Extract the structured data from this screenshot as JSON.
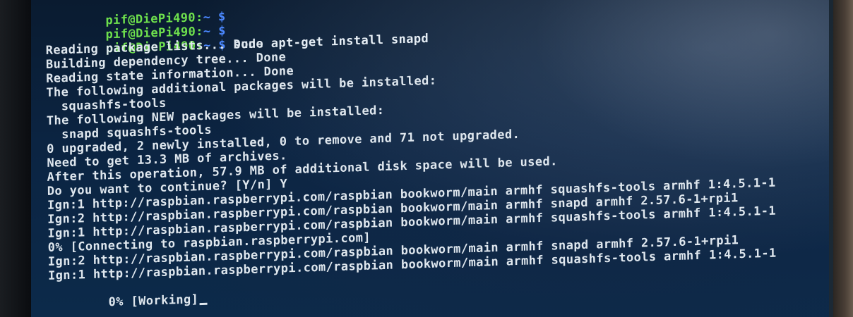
{
  "terminal": {
    "prompts": [
      {
        "user_host": "pif@DiePi490:",
        "path": "~",
        "symbol": "$",
        "command": ""
      },
      {
        "user_host": "pif@DiePi490:",
        "path": "~",
        "symbol": "$",
        "command": ""
      },
      {
        "user_host": "pif@DiePi490:",
        "path": "~",
        "symbol": "$",
        "command": " sudo apt-get install snapd"
      }
    ],
    "output": [
      "Reading package lists... Done",
      "Building dependency tree... Done",
      "Reading state information... Done",
      "The following additional packages will be installed:",
      "  squashfs-tools",
      "The following NEW packages will be installed:",
      "  snapd squashfs-tools",
      "0 upgraded, 2 newly installed, 0 to remove and 71 not upgraded.",
      "Need to get 13.3 MB of archives.",
      "After this operation, 57.9 MB of additional disk space will be used.",
      "Do you want to continue? [Y/n] Y",
      "Ign:1 http://raspbian.raspberrypi.com/raspbian bookworm/main armhf squashfs-tools armhf 1:4.5.1-1",
      "Ign:2 http://raspbian.raspberrypi.com/raspbian bookworm/main armhf snapd armhf 2.57.6-1+rpi1",
      "Ign:1 http://raspbian.raspberrypi.com/raspbian bookworm/main armhf squashfs-tools armhf 1:4.5.1-1",
      "0% [Connecting to raspbian.raspberrypi.com]",
      "Ign:2 http://raspbian.raspberrypi.com/raspbian bookworm/main armhf snapd armhf 2.57.6-1+rpi1",
      "Ign:1 http://raspbian.raspberrypi.com/raspbian bookworm/main armhf squashfs-tools armhf 1:4.5.1-1"
    ],
    "current_line": "0% [Working]"
  },
  "colors": {
    "prompt_user": "#6ee04d",
    "prompt_path": "#4b88ff",
    "text": "#dfe7ee",
    "background": "#0b2442"
  }
}
